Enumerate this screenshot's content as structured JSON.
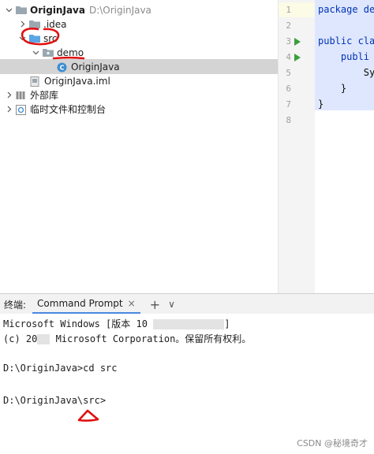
{
  "project_tree": {
    "root": {
      "name": "OriginJava",
      "path": "D:\\OriginJava"
    },
    "items": [
      {
        "label": ".idea"
      },
      {
        "label": "src"
      },
      {
        "label": "demo"
      },
      {
        "label": "OriginJava",
        "selected": true
      },
      {
        "label": "OriginJava.iml"
      },
      {
        "label": "外部库"
      },
      {
        "label": "临时文件和控制台"
      }
    ]
  },
  "editor": {
    "line_numbers": [
      "1",
      "2",
      "3",
      "4",
      "5",
      "6",
      "7",
      "8"
    ],
    "code_lines": [
      "package de",
      "",
      "public cla",
      "    publi",
      "        Sy",
      "    }",
      "}",
      ""
    ]
  },
  "terminal": {
    "title": "终端:",
    "tab_label": "Command Prompt",
    "tab_close": "×",
    "add_tab": "+",
    "more": "∨",
    "lines": [
      "Microsoft Windows [版本 10",
      "]",
      "(c) 20",
      " Microsoft Corporation。保留所有权利。",
      "D:\\OriginJava>cd src",
      "D:\\OriginJava\\src>"
    ]
  },
  "watermark": "CSDN @秘境奇才",
  "colors": {
    "annotation_red": "#e01010",
    "run_green": "#3a9f3a",
    "selection_gray": "#d4d4d4",
    "tab_accent": "#4a87e0"
  }
}
